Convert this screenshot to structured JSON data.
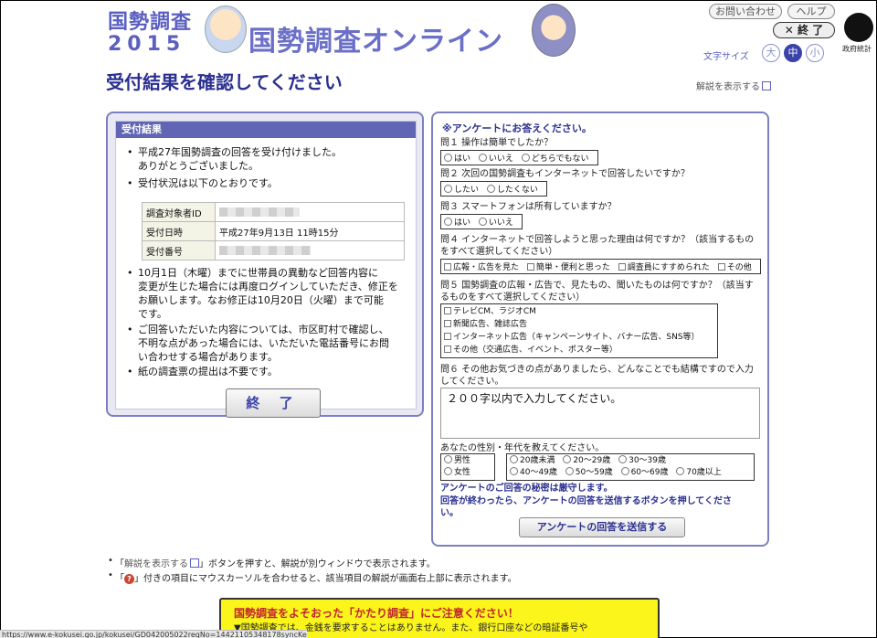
{
  "header": {
    "logo_line1": "国勢調査",
    "logo_line2": "2015",
    "site_title": "国勢調査オンライン",
    "inquiry_label": "お問い合わせ",
    "help_label": "ヘルプ",
    "close_label": "✕ 終 了",
    "gov_logo_label": "政府統計",
    "font_size_label": "文字サイズ",
    "font_sizes": [
      "大",
      "中",
      "小"
    ]
  },
  "page_title": "受付結果を確認してください",
  "explain_link": "解説を表示する",
  "result": {
    "section_title": "受付結果",
    "bullet1_l1": "平成27年国勢調査の回答を受け付けました。",
    "bullet1_l2": "ありがとうございました。",
    "bullet2": "受付状況は以下のとおりです。",
    "rows": [
      {
        "label": "調査対象者ID",
        "value": ""
      },
      {
        "label": "受付日時",
        "value": "平成27年9月13日 11時15分"
      },
      {
        "label": "受付番号",
        "value": ""
      }
    ],
    "bullet3_l1": "10月1日（木曜）までに世帯員の異動など回答内容に",
    "bullet3_l2": "変更が生じた場合には再度ログインしていただき、修正を",
    "bullet3_l3": "お願いします。なお修正は10月20日（火曜）まで可能",
    "bullet3_l4": "です。",
    "bullet4_l1": "ご回答いただいた内容については、市区町村で確認し、",
    "bullet4_l2": "不明な点があった場合には、いただいた電話番号にお問",
    "bullet4_l3": "い合わせする場合があります。",
    "bullet5": "紙の調査票の提出は不要です。",
    "end_button": "終 了"
  },
  "survey": {
    "heading": "※アンケートにお答えください。",
    "q1": "問１ 操作は簡単でしたか？",
    "q1_opts": [
      "はい",
      "いいえ",
      "どちらでもない"
    ],
    "q2": "問２ 次回の国勢調査もインターネットで回答したいですか？",
    "q2_opts": [
      "したい",
      "したくない"
    ],
    "q3": "問３ スマートフォンは所有していますか？",
    "q3_opts": [
      "はい",
      "いいえ"
    ],
    "q4_l1": "問４ インターネットで回答しようと思った理由は何ですか？（該当するもの",
    "q4_l2": "をすべて選択してください）",
    "q4_opts": [
      "広報・広告を見た",
      "簡単・便利と思った",
      "調査員にすすめられた",
      "その他"
    ],
    "q5_l1": "問５ 国勢調査の広報・広告で、見たもの、聞いたものは何ですか？（該当す",
    "q5_l2": "るものをすべて選択してください）",
    "q5_opts": [
      "テレビCM、ラジオCM",
      "新聞広告、雑誌広告",
      "インターネット広告（キャンペーンサイト、バナー広告、SNS等）",
      "その他（交通広告、イベント、ポスター等）"
    ],
    "q6_l1": "問６ その他お気づきの点がありましたら、どんなことでも結構ですので入力",
    "q6_l2": "してください。",
    "q6_placeholder": "２００字以内で入力してください。",
    "gender_age_label": "あなたの性別・年代を教えてください。",
    "gender_opts": [
      "男性",
      "女性"
    ],
    "age_row1": [
      "20歳未満",
      "20〜29歳",
      "30〜39歳"
    ],
    "age_row2": [
      "40〜49歳",
      "50〜59歳",
      "60〜69歳",
      "70歳以上"
    ],
    "notice1": "アンケートのご回答の秘密は厳守します。",
    "notice2_l1": "回答が終わったら、アンケートの回答を送信するボタンを押してくださ",
    "notice2_l2": "い。",
    "submit": "アンケートの回答を送信する"
  },
  "notes": {
    "n1_pre": "「",
    "n1_link": "解説を表示する",
    "n1_post": "」ボタンを押すと、解説が別ウィンドウで表示されます。",
    "n2_pre": "「",
    "n2_icon": "?",
    "n2_post": "」付きの項目にマウスカーソルを合わせると、該当項目の解説が画面右上部に表示されます。"
  },
  "warning": {
    "title": "国勢調査をよそおった「かたり調査」にご注意ください！",
    "body": "▼国勢調査では、金銭を要求することはありません。また、銀行口座などの暗証番号や"
  },
  "status_url": "https://www.e-kokusei.go.jp/kokusei/GD042005022reqNo=14421105348178syncKey=#"
}
